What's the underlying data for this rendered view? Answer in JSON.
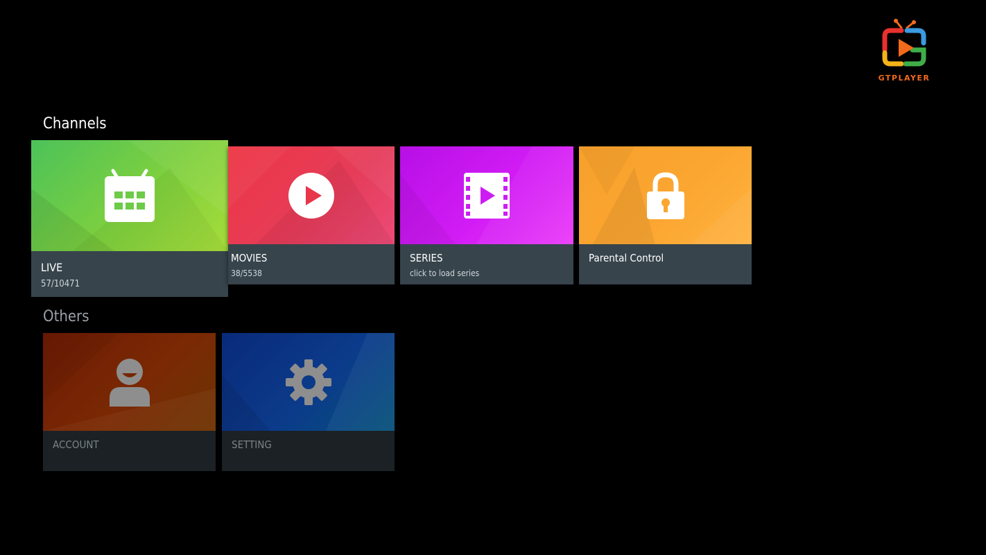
{
  "brand": {
    "logo_text": "GTPLAYER",
    "accent_orange": "#f26a1b"
  },
  "sections": {
    "channels_title": "Channels",
    "others_title": "Others"
  },
  "channels": {
    "live": {
      "title": "LIVE",
      "subtitle": "57/10471",
      "icon": "tv-calendar-icon",
      "color": "#6ccb47"
    },
    "movies": {
      "title": "MOVIES",
      "subtitle": "38/5538",
      "icon": "play-circle-icon",
      "color": "#ea3d55"
    },
    "series": {
      "title": "SERIES",
      "subtitle": "click to load series",
      "icon": "film-play-icon",
      "color": "#cc1df2"
    },
    "parental": {
      "title": "Parental Control",
      "icon": "padlock-icon",
      "color": "#fba631"
    }
  },
  "others": {
    "account": {
      "title": "ACCOUNT",
      "icon": "user-icon",
      "color": "#752503"
    },
    "setting": {
      "title": "SETTING",
      "icon": "gear-icon",
      "color": "#0b3a88"
    }
  }
}
